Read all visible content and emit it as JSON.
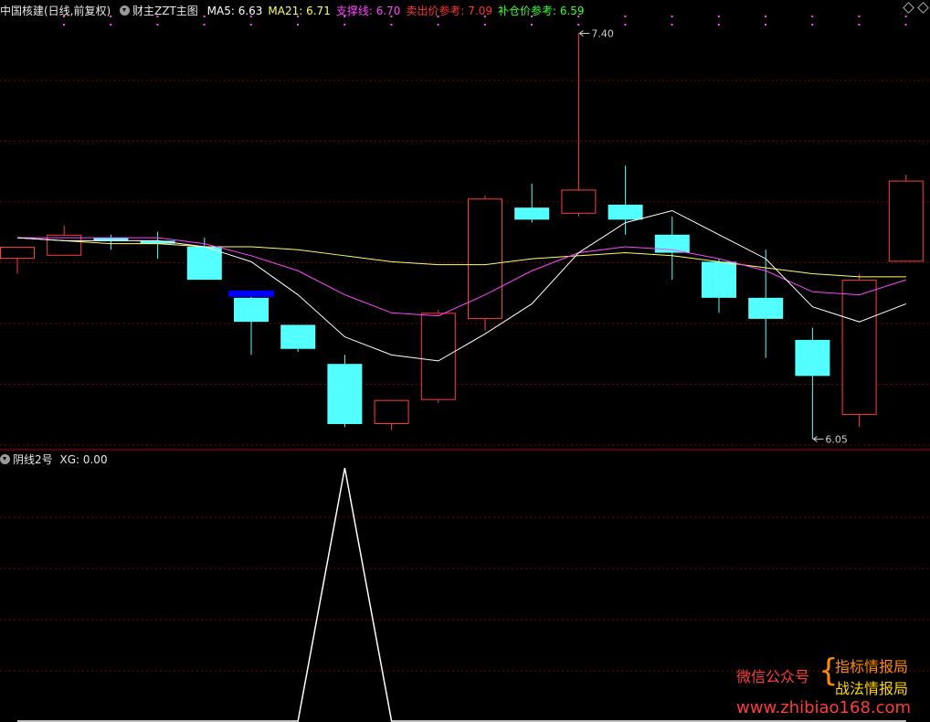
{
  "header": {
    "title": "中国核建(日线,前复权)",
    "indicator_name": "财主ZZT主图",
    "items": [
      {
        "label": "MA5: ",
        "value": "6.63",
        "color": "#ffffff"
      },
      {
        "label": "MA21: ",
        "value": "6.71",
        "color": "#ffff66"
      },
      {
        "label": "支撑线: ",
        "value": "6.70",
        "color": "#ff44ff"
      },
      {
        "label": "卖出价参考: ",
        "value": "7.09",
        "color": "#ff3333"
      },
      {
        "label": "补仓价参考: ",
        "value": "6.59",
        "color": "#33ff33"
      }
    ]
  },
  "sub_header": {
    "indicator_name": "阴线2号",
    "label": "XG: ",
    "value": "0.00"
  },
  "watermark": {
    "left_text": "微信公众号",
    "brace": "{",
    "line1": "指标情报局",
    "line2": "战法情报局",
    "url": "www.zhibiao168.com"
  },
  "chart_data": [
    {
      "type": "candlestick",
      "annotations": [
        {
          "text": "7.40",
          "candle_index": 12,
          "value": 7.4
        },
        {
          "text": "6.05",
          "candle_index": 17,
          "value": 6.05
        }
      ],
      "colors": {
        "up": "#ff3c3c",
        "down": "#54ffff",
        "ma5": "#ffffff",
        "ma21": "#ffff66",
        "support": "#ff44ff",
        "grid": "#7a0000"
      },
      "y_range": [
        6.03,
        7.45
      ],
      "candles": [
        {
          "o": 6.65,
          "h": 6.69,
          "l": 6.6,
          "c": 6.69
        },
        {
          "o": 6.66,
          "h": 6.76,
          "l": 6.66,
          "c": 6.73
        },
        {
          "o": 6.72,
          "h": 6.73,
          "l": 6.68,
          "c": 6.71
        },
        {
          "o": 6.71,
          "h": 6.74,
          "l": 6.65,
          "c": 6.7
        },
        {
          "o": 6.69,
          "h": 6.72,
          "l": 6.58,
          "c": 6.58
        },
        {
          "o": 6.52,
          "h": 6.53,
          "l": 6.33,
          "c": 6.44
        },
        {
          "o": 6.43,
          "h": 6.43,
          "l": 6.34,
          "c": 6.35
        },
        {
          "o": 6.3,
          "h": 6.33,
          "l": 6.09,
          "c": 6.1
        },
        {
          "o": 6.1,
          "h": 6.18,
          "l": 6.08,
          "c": 6.18
        },
        {
          "o": 6.18,
          "h": 6.48,
          "l": 6.17,
          "c": 6.47
        },
        {
          "o": 6.45,
          "h": 6.86,
          "l": 6.41,
          "c": 6.85
        },
        {
          "o": 6.82,
          "h": 6.9,
          "l": 6.77,
          "c": 6.78
        },
        {
          "o": 6.8,
          "h": 7.4,
          "l": 6.79,
          "c": 6.88
        },
        {
          "o": 6.83,
          "h": 6.96,
          "l": 6.73,
          "c": 6.78
        },
        {
          "o": 6.73,
          "h": 6.79,
          "l": 6.58,
          "c": 6.67
        },
        {
          "o": 6.64,
          "h": 6.65,
          "l": 6.47,
          "c": 6.52
        },
        {
          "o": 6.52,
          "h": 6.68,
          "l": 6.32,
          "c": 6.45
        },
        {
          "o": 6.38,
          "h": 6.42,
          "l": 6.05,
          "c": 6.26
        },
        {
          "o": 6.13,
          "h": 6.6,
          "l": 6.09,
          "c": 6.58
        },
        {
          "o": 6.64,
          "h": 6.93,
          "l": 6.64,
          "c": 6.91
        }
      ],
      "marker_candle_index": 5,
      "ma5": [
        6.72,
        6.71,
        6.71,
        6.71,
        6.69,
        6.64,
        6.53,
        6.39,
        6.33,
        6.31,
        6.4,
        6.5,
        6.67,
        6.77,
        6.81,
        6.73,
        6.65,
        6.49,
        6.44,
        6.5
      ],
      "ma21": [
        6.72,
        6.71,
        6.7,
        6.7,
        6.69,
        6.69,
        6.68,
        6.66,
        6.64,
        6.63,
        6.63,
        6.65,
        6.66,
        6.67,
        6.66,
        6.64,
        6.62,
        6.6,
        6.59,
        6.59
      ],
      "support": [
        6.72,
        6.72,
        6.72,
        6.72,
        6.7,
        6.66,
        6.61,
        6.53,
        6.47,
        6.46,
        6.53,
        6.61,
        6.67,
        6.69,
        6.68,
        6.65,
        6.61,
        6.54,
        6.53,
        6.58
      ]
    },
    {
      "type": "line",
      "series": [
        {
          "values": [
            0,
            0,
            0,
            0,
            0,
            0,
            0,
            1,
            0,
            0,
            0,
            0,
            0,
            0,
            0,
            0,
            0,
            0,
            0,
            0
          ]
        }
      ],
      "y_range": [
        0,
        1
      ]
    }
  ]
}
